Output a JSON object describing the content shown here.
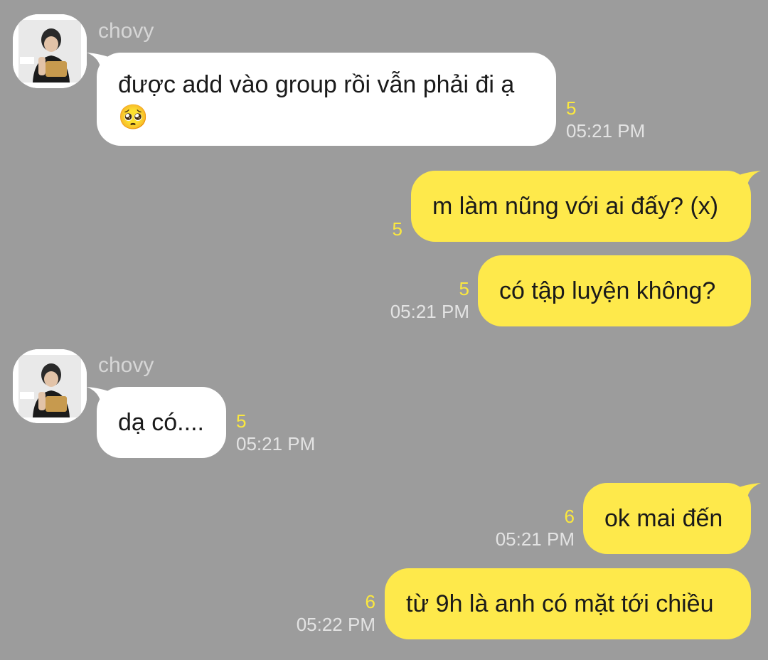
{
  "theme": {
    "background": "#9c9c9c",
    "incoming_bubble": "#ffffff",
    "outgoing_bubble": "#fee94b",
    "unread_count_color": "#fbe83e",
    "timestamp_color": "#e3e3e3"
  },
  "messages": [
    {
      "direction": "incoming",
      "sender": "chovy",
      "text": "được add vào group rồi vẫn phải đi ạ",
      "emoji": "🥺",
      "emoji_icon": "pleading-face-icon",
      "unread": "5",
      "time": "05:21 PM"
    },
    {
      "direction": "outgoing",
      "text": "m làm nũng với ai đấy? (x)",
      "unread": "5",
      "time": ""
    },
    {
      "direction": "outgoing",
      "text": "có tập luyện không?",
      "unread": "5",
      "time": "05:21 PM"
    },
    {
      "direction": "incoming",
      "sender": "chovy",
      "text": "dạ có....",
      "unread": "5",
      "time": "05:21 PM"
    },
    {
      "direction": "outgoing",
      "text": "ok mai đến",
      "unread": "6",
      "time": "05:21 PM"
    },
    {
      "direction": "outgoing",
      "text": "từ 9h là anh có mặt tới chiều",
      "unread": "6",
      "time": "05:22 PM"
    }
  ]
}
